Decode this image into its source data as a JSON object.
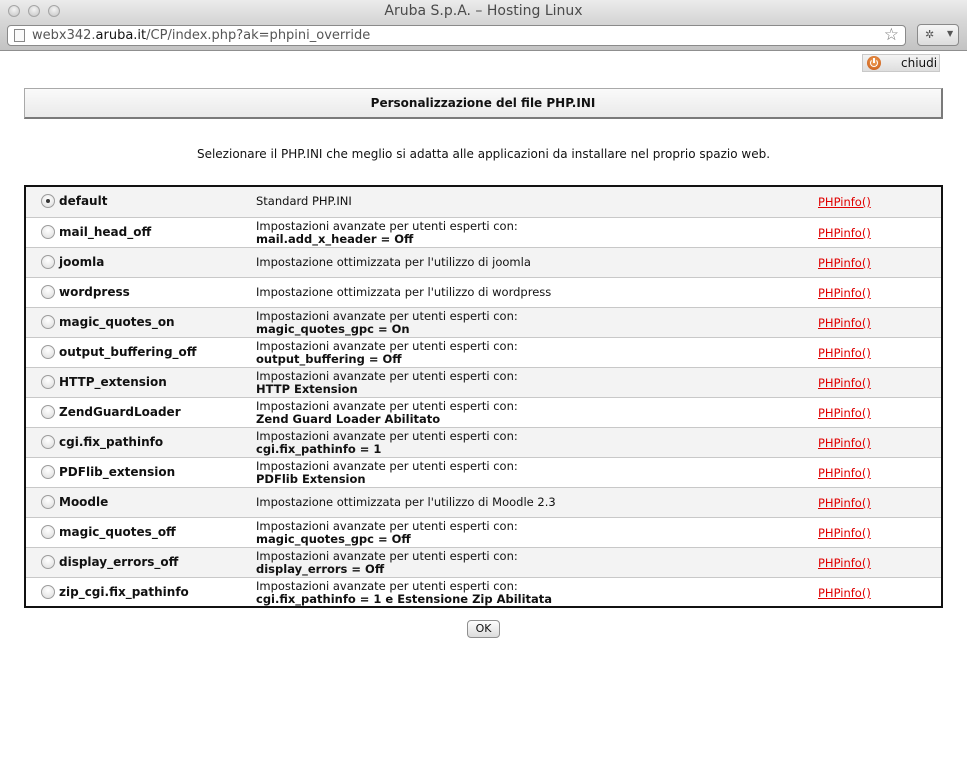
{
  "window": {
    "title": "Aruba S.p.A. – Hosting Linux"
  },
  "address_bar": {
    "url_prefix": "webx342.",
    "url_domain": "aruba.it",
    "url_path": "/CP/index.php?ak=phpini_override"
  },
  "header": {
    "close_label": "chiudi"
  },
  "main": {
    "heading": "Personalizzazione del file PHP.INI",
    "intro": "Selezionare il PHP.INI che meglio si adatta alle applicazioni da installare nel proprio spazio web.",
    "ok_label": "OK",
    "rows": [
      {
        "name": "default",
        "desc1": "Standard PHP.INI",
        "desc2": "",
        "link": "PHPinfo()",
        "selected": true
      },
      {
        "name": "mail_head_off",
        "desc1": "Impostazioni avanzate per utenti esperti con:",
        "desc2": "mail.add_x_header = Off",
        "link": "PHPinfo()",
        "selected": false
      },
      {
        "name": "joomla",
        "desc1": "Impostazione ottimizzata per l'utilizzo di joomla",
        "desc2": "",
        "link": "PHPinfo()",
        "selected": false
      },
      {
        "name": "wordpress",
        "desc1": "Impostazione ottimizzata per l'utilizzo di wordpress",
        "desc2": "",
        "link": "PHPinfo()",
        "selected": false
      },
      {
        "name": "magic_quotes_on",
        "desc1": "Impostazioni avanzate per utenti esperti con:",
        "desc2": "magic_quotes_gpc = On",
        "link": "PHPinfo()",
        "selected": false
      },
      {
        "name": "output_buffering_off",
        "desc1": "Impostazioni avanzate per utenti esperti con:",
        "desc2": "output_buffering = Off",
        "link": "PHPinfo()",
        "selected": false
      },
      {
        "name": "HTTP_extension",
        "desc1": "Impostazioni avanzate per utenti esperti con:",
        "desc2": "HTTP Extension",
        "link": "PHPinfo()",
        "selected": false
      },
      {
        "name": "ZendGuardLoader",
        "desc1": "Impostazioni avanzate per utenti esperti con:",
        "desc2": "Zend Guard Loader Abilitato",
        "link": "PHPinfo()",
        "selected": false
      },
      {
        "name": "cgi.fix_pathinfo",
        "desc1": "Impostazioni avanzate per utenti esperti con:",
        "desc2": "cgi.fix_pathinfo = 1",
        "link": "PHPinfo()",
        "selected": false
      },
      {
        "name": "PDFlib_extension",
        "desc1": "Impostazioni avanzate per utenti esperti con:",
        "desc2": "PDFlib Extension",
        "link": "PHPinfo()",
        "selected": false
      },
      {
        "name": "Moodle",
        "desc1": "Impostazione ottimizzata per l'utilizzo di Moodle 2.3",
        "desc2": "",
        "link": "PHPinfo()",
        "selected": false
      },
      {
        "name": "magic_quotes_off",
        "desc1": "Impostazioni avanzate per utenti esperti con:",
        "desc2": "magic_quotes_gpc = Off",
        "link": "PHPinfo()",
        "selected": false
      },
      {
        "name": "display_errors_off",
        "desc1": "Impostazioni avanzate per utenti esperti con:",
        "desc2": "display_errors = Off",
        "link": "PHPinfo()",
        "selected": false
      },
      {
        "name": "zip_cgi.fix_pathinfo",
        "desc1": "Impostazioni avanzate per utenti esperti con:",
        "desc2": "cgi.fix_pathinfo = 1 e Estensione Zip Abilitata",
        "link": "PHPinfo()",
        "selected": false
      }
    ]
  }
}
